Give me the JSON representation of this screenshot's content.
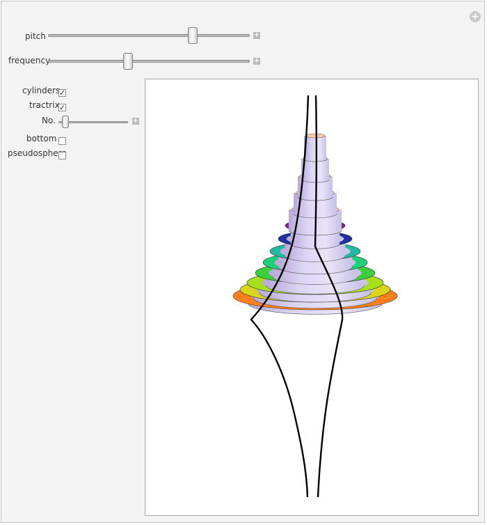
{
  "controls": {
    "pitch": {
      "label": "pitch",
      "value": 0.73
    },
    "frequency": {
      "label": "frequency",
      "value": 0.39
    },
    "cylinders": {
      "label": "cylinders",
      "checked": true
    },
    "tractrix": {
      "label": "tractrix",
      "checked": true
    },
    "number": {
      "label": "No.",
      "value": 0.05
    },
    "bottom": {
      "label": "bottom",
      "checked": false
    },
    "pseudosphere": {
      "label": "pseudosphere",
      "checked": false
    }
  },
  "glyphs": {
    "check": "✓",
    "plus": "+"
  },
  "icons": [
    "add-circle-icon",
    "plus-icon",
    "checkmark-icon"
  ],
  "colors": {
    "background": "#f3f3f3",
    "cylinder_body": "#c9bfe6",
    "cylinder_top": "#f6cba6",
    "ring_colors": [
      "#ff7f1a",
      "#d9d61c",
      "#a6e01c",
      "#3ccf3c",
      "#1ed07a",
      "#23b8a0",
      "#1f2f9e",
      "#8a1f8f"
    ],
    "curve": "#000000"
  }
}
